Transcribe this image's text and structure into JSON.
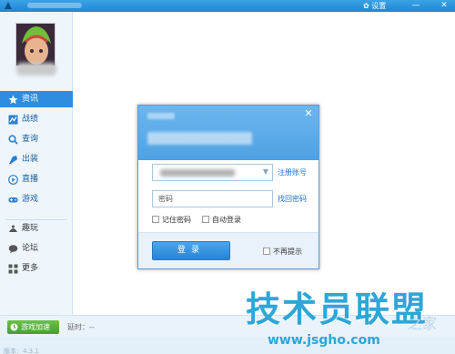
{
  "titlebar": {
    "settings_label": "✿ 设置",
    "minimize_glyph": "—",
    "close_glyph": "✕"
  },
  "sidebar": {
    "items": [
      {
        "label": "资讯",
        "icon": "star-icon",
        "active": true
      },
      {
        "label": "战绩",
        "icon": "chart-icon",
        "active": false
      },
      {
        "label": "查询",
        "icon": "search-icon",
        "active": false
      },
      {
        "label": "出装",
        "icon": "equipment-icon",
        "active": false
      },
      {
        "label": "直播",
        "icon": "play-icon",
        "active": false
      },
      {
        "label": "游戏",
        "icon": "gamepad-icon",
        "active": false
      },
      {
        "label": "趣玩",
        "icon": "fun-icon",
        "active": false
      },
      {
        "label": "论坛",
        "icon": "chat-bubble-icon",
        "active": false
      },
      {
        "label": "更多",
        "icon": "grid-icon",
        "active": false
      }
    ]
  },
  "statusbar": {
    "speed_button": "游戏加速",
    "delay_label": "延时：--",
    "version_label": "版本：4.3.1"
  },
  "dialog": {
    "account_placeholder": "",
    "register_link": "注册账号",
    "password_placeholder": "密码",
    "find_password_link": "找回密码",
    "remember_password": "记住密码",
    "auto_login": "自动登录",
    "login_button": "登录",
    "no_remind": "不再提示",
    "close_glyph": "✕"
  },
  "watermark": {
    "title": "技术员联盟",
    "url": "www.jsgho.com",
    "extra": "之家"
  },
  "colors": {
    "accent": "#2f8ce0",
    "titlebar": "#1f86d3",
    "watermark": "#2ea6d8"
  }
}
